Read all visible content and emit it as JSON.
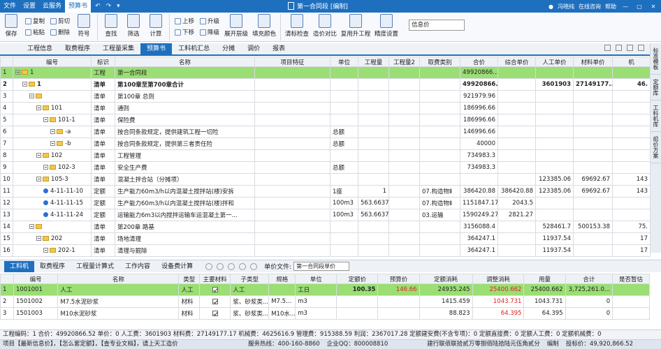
{
  "titlebar": {
    "menus": [
      "文件",
      "设置",
      "云服务",
      "预算书"
    ],
    "active_menu": "预算书",
    "doc_title": "第一合同段 [编制]",
    "user": "冯晓纯",
    "online": "在线咨询",
    "help": "帮助"
  },
  "ribbon": {
    "save": "保存",
    "copy": "复制",
    "cut": "剪切",
    "paste": "粘贴",
    "delete": "删除",
    "symbol": "符号",
    "find": "查找",
    "filter": "筛选",
    "calc": "计算",
    "up": "上移",
    "down": "下移",
    "upgrade": "升级",
    "downgrade": "降级",
    "expand": "展开层级",
    "fill_color": "填充颜色",
    "clear_mark": "清标检查",
    "compare": "造价对比",
    "reuse": "复用升工程",
    "quota_settings": "精度设置",
    "search_placeholder": "信息价"
  },
  "tabs": [
    "工程信息",
    "取费程序",
    "工程量采集",
    "预算书",
    "工料机汇总",
    "分摊",
    "调价",
    "报表"
  ],
  "active_tab": "预算书",
  "side_tabs": [
    "标准模板",
    "定额库",
    "工料机库",
    "组价方案"
  ],
  "upper": {
    "headers": [
      "编号",
      "标识",
      "名称",
      "项目特征",
      "单位",
      "工程量",
      "工程量2",
      "取费类别",
      "合价",
      "综合单价",
      "人工单价",
      "材料单价",
      "机"
    ],
    "rows": [
      {
        "n": "1",
        "id": "1",
        "tag": "工程",
        "name": "第一合同段",
        "feat": "",
        "unit": "",
        "qty": "",
        "qty2": "",
        "fee": "",
        "total": "49920866...",
        "unitp": "",
        "lab": "",
        "mat": "",
        "mach": "",
        "indent": 0,
        "icon": "fold",
        "cls": "hl"
      },
      {
        "n": "2",
        "id": "1",
        "tag": "清单",
        "name": "第100章至第700章合计",
        "feat": "",
        "unit": "",
        "qty": "",
        "qty2": "",
        "fee": "",
        "total": "49920866...",
        "unitp": "",
        "lab": "3601903",
        "mat": "27149177...",
        "mach": "46.",
        "indent": 1,
        "icon": "fold",
        "cls": "bold"
      },
      {
        "n": "3",
        "id": "",
        "tag": "清单",
        "name": "第100章 总则",
        "feat": "",
        "unit": "",
        "qty": "",
        "qty2": "",
        "fee": "",
        "total": "921979.96",
        "unitp": "",
        "lab": "",
        "mat": "",
        "mach": "",
        "indent": 2,
        "icon": "fold",
        "cls": ""
      },
      {
        "n": "4",
        "id": "101",
        "tag": "清单",
        "name": "通则",
        "feat": "",
        "unit": "",
        "qty": "",
        "qty2": "",
        "fee": "",
        "total": "186996.66",
        "unitp": "",
        "lab": "",
        "mat": "",
        "mach": "",
        "indent": 3,
        "icon": "fold",
        "cls": ""
      },
      {
        "n": "5",
        "id": "101-1",
        "tag": "清单",
        "name": "保险费",
        "feat": "",
        "unit": "",
        "qty": "",
        "qty2": "",
        "fee": "",
        "total": "186996.66",
        "unitp": "",
        "lab": "",
        "mat": "",
        "mach": "",
        "indent": 4,
        "icon": "fold",
        "cls": ""
      },
      {
        "n": "6",
        "id": "-a",
        "tag": "清单",
        "name": "按合同条款规定，提供建筑工程一切险",
        "feat": "",
        "unit": "总额",
        "qty": "",
        "qty2": "",
        "fee": "",
        "total": "146996.66",
        "unitp": "",
        "lab": "",
        "mat": "",
        "mach": "",
        "indent": 5,
        "icon": "fold",
        "cls": ""
      },
      {
        "n": "7",
        "id": "-b",
        "tag": "清单",
        "name": "按合同条款规定，提供第三者责任险",
        "feat": "",
        "unit": "总额",
        "qty": "",
        "qty2": "",
        "fee": "",
        "total": "40000",
        "unitp": "",
        "lab": "",
        "mat": "",
        "mach": "",
        "indent": 5,
        "icon": "fold",
        "cls": ""
      },
      {
        "n": "8",
        "id": "102",
        "tag": "清单",
        "name": "工程管理",
        "feat": "",
        "unit": "",
        "qty": "",
        "qty2": "",
        "fee": "",
        "total": "734983.3",
        "unitp": "",
        "lab": "",
        "mat": "",
        "mach": "",
        "indent": 3,
        "icon": "fold",
        "cls": ""
      },
      {
        "n": "9",
        "id": "102-3",
        "tag": "清单",
        "name": "安全生产费",
        "feat": "",
        "unit": "总额",
        "qty": "",
        "qty2": "",
        "fee": "",
        "total": "734983.3",
        "unitp": "",
        "lab": "",
        "mat": "",
        "mach": "",
        "indent": 4,
        "icon": "fold",
        "cls": ""
      },
      {
        "n": "10",
        "id": "105-3",
        "tag": "清单",
        "name": "混凝土拌合站（分摊项）",
        "feat": "",
        "unit": "",
        "qty": "",
        "qty2": "",
        "fee": "",
        "total": "",
        "unitp": "",
        "lab": "123385.06",
        "mat": "69692.67",
        "mach": "143",
        "indent": 3,
        "icon": "fold",
        "cls": ""
      },
      {
        "n": "11",
        "id": "4-11-11-10",
        "tag": "定额",
        "name": "生产能力60m3/h以内混凝土搅拌站(楼)安拆",
        "feat": "",
        "unit": "1座",
        "qty": "1",
        "qty2": "",
        "fee": "07.构造物Ⅱ",
        "total": "386420.88",
        "unitp": "386420.88",
        "lab": "123385.06",
        "mat": "69692.67",
        "mach": "143",
        "indent": 4,
        "icon": "dot",
        "cls": ""
      },
      {
        "n": "12",
        "id": "4-11-11-15",
        "tag": "定额",
        "name": "生产能力60m3/h以内混凝土搅拌站(楼)拌和",
        "feat": "",
        "unit": "100m3",
        "qty": "563.6637",
        "qty2": "",
        "fee": "07.构造物Ⅱ",
        "total": "1151847.17",
        "unitp": "2043.5",
        "lab": "",
        "mat": "",
        "mach": "",
        "indent": 4,
        "icon": "dot",
        "cls": ""
      },
      {
        "n": "13",
        "id": "4-11-11-24",
        "tag": "定额",
        "name": "运输能力6m3以内搅拌运输车运混凝土第一...",
        "feat": "",
        "unit": "100m3",
        "qty": "563.6637",
        "qty2": "",
        "fee": "03.运输",
        "total": "1590249.27",
        "unitp": "2821.27",
        "lab": "",
        "mat": "",
        "mach": "",
        "indent": 4,
        "icon": "dot",
        "cls": ""
      },
      {
        "n": "14",
        "id": "",
        "tag": "清单",
        "name": "第200章 路基",
        "feat": "",
        "unit": "",
        "qty": "",
        "qty2": "",
        "fee": "",
        "total": "3156088.4",
        "unitp": "",
        "lab": "528461.7",
        "mat": "500153.38",
        "mach": "75.",
        "indent": 2,
        "icon": "fold",
        "cls": ""
      },
      {
        "n": "15",
        "id": "202",
        "tag": "清单",
        "name": "场地清理",
        "feat": "",
        "unit": "",
        "qty": "",
        "qty2": "",
        "fee": "",
        "total": "364247.1",
        "unitp": "",
        "lab": "11937.54",
        "mat": "",
        "mach": "17",
        "indent": 3,
        "icon": "fold",
        "cls": ""
      },
      {
        "n": "16",
        "id": "202-1",
        "tag": "清单",
        "name": "清理与掘除",
        "feat": "",
        "unit": "",
        "qty": "",
        "qty2": "",
        "fee": "",
        "total": "364247.1",
        "unitp": "",
        "lab": "11937.54",
        "mat": "",
        "mach": "17",
        "indent": 4,
        "icon": "fold",
        "cls": ""
      }
    ]
  },
  "lower_tabs": {
    "items": [
      "工料机",
      "取费程序",
      "工程量计算式",
      "工作内容",
      "设备费计算"
    ],
    "active": "工料机",
    "unit_file_label": "单价文件:",
    "unit_file_value": "第一合同段单价"
  },
  "lower": {
    "headers": [
      "编号",
      "名称",
      "类型",
      "主要材料",
      "子类型",
      "规格",
      "单位",
      "定额价",
      "预算价",
      "定额消耗",
      "调整消耗",
      "用量",
      "合计",
      "是否暂估"
    ],
    "rows": [
      {
        "n": "1",
        "code": "1001001",
        "name": "人工",
        "type": "人工",
        "main": true,
        "sub": "人工",
        "spec": "",
        "unit": "工日",
        "qp": "100.35",
        "bp": "146.66",
        "qc": "24935.245",
        "ac": "25400.662",
        "use": "25400.662",
        "sum": "3,725,261.0...",
        "est": "",
        "cls": "hl"
      },
      {
        "n": "2",
        "code": "1501002",
        "name": "M7.5水泥砂浆",
        "type": "材料",
        "main": true,
        "sub": "浆、砂浆类...",
        "spec": "M7.5...",
        "unit": "m3",
        "qp": "",
        "bp": "",
        "qc": "1415.459",
        "ac": "1043.731",
        "use": "1043.731",
        "sum": "0",
        "est": "",
        "cls": ""
      },
      {
        "n": "3",
        "code": "1501003",
        "name": "M10水泥砂浆",
        "type": "材料",
        "main": true,
        "sub": "浆、砂浆类...",
        "spec": "M10水...",
        "unit": "m3",
        "qp": "",
        "bp": "",
        "qc": "88.823",
        "ac": "64.395",
        "use": "64.395",
        "sum": "0",
        "est": "",
        "cls": ""
      }
    ]
  },
  "status1": "工程编码：1   合价：49920866.52   单价：0   人工费：3601903   材料费：27149177.17   机械费：4625616.9   管理费：915388.59   利润：2367017.28   定额建安费(不含专项)：0   定额直接费：0   定额人工费：0   定额机械费：0",
  "status2": {
    "left": "项目【最新信息价】，【怎么套定额】，【查专业文档】，请上天工造价",
    "hotline": "服务热线：400-160-8860",
    "qq": "企业QQ：800008810",
    "code": "建行联佰联拾贰万零捌佰陆拾陆元伍角贰分",
    "mode": "编制",
    "total": "投标价：49,920,866.52"
  }
}
